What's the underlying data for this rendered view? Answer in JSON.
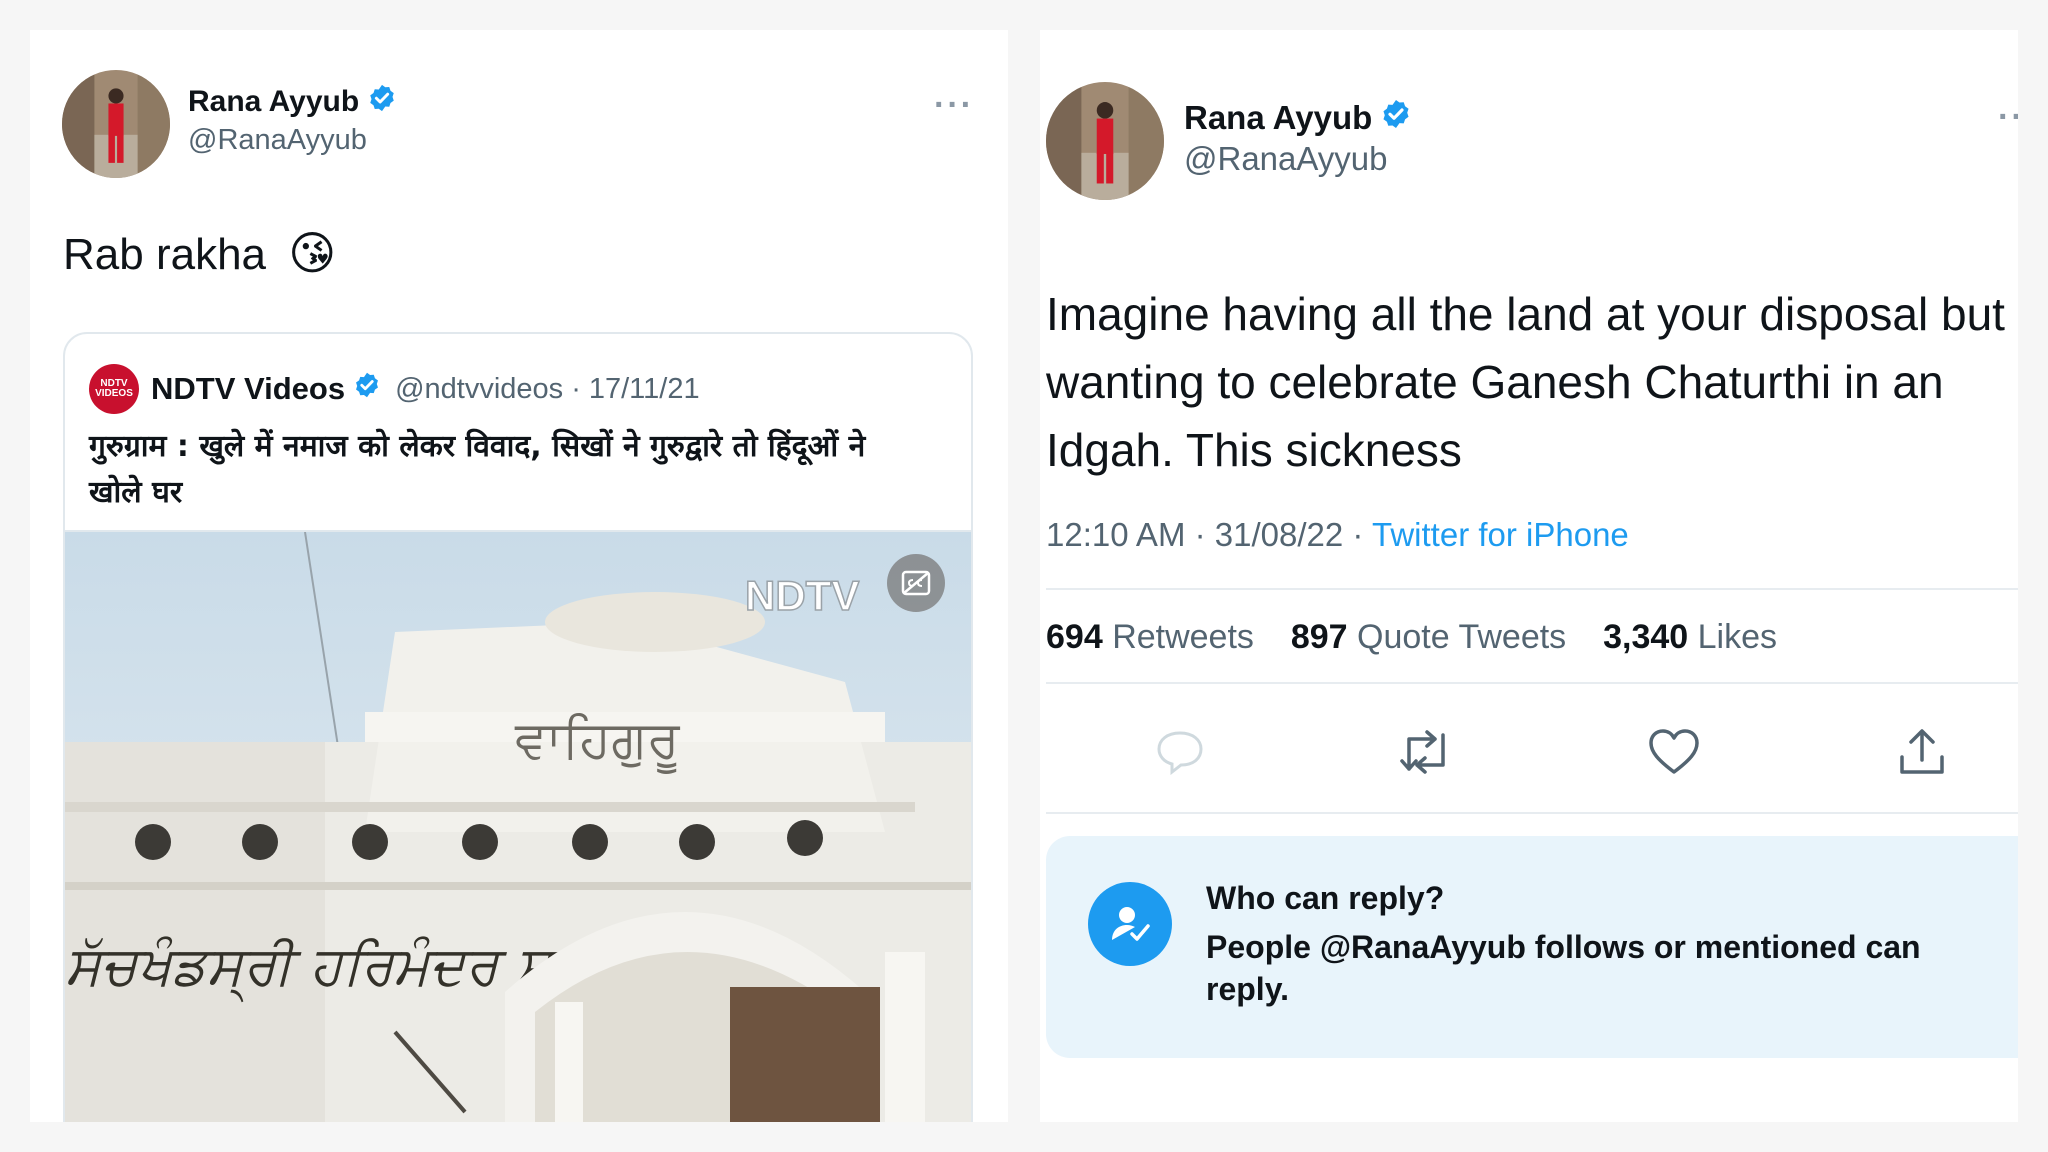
{
  "left_tweet": {
    "author_name": "Rana Ayyub",
    "author_handle": "@RanaAyyub",
    "more_label": "···",
    "text": "Rab rakha",
    "emoji": "😘",
    "quote": {
      "source_logo_text": "NDTV VIDEOS",
      "source_name": "NDTV Videos",
      "source_handle": "@ndtvvideos",
      "separator": "·",
      "date": "17/11/21",
      "text": "गुरुग्राम : खुले में नमाज को लेकर विवाद, सिखों ने गुरुद्वारे तो हिंदूओं ने खोले घर",
      "media_watermark": "NDTV",
      "media_sign_text": "ਵਾਹਿਗੁਰੂ",
      "media_wall_text": "ਸੱਚਖੰਡਸ੍ਰੀ ਹਰਿਮੰਦਰ ਸਾਹਿਬ"
    }
  },
  "right_tweet": {
    "author_name": "Rana Ayyub",
    "author_handle": "@RanaAyyub",
    "more_label": "··",
    "text": "Imagine having all the land at your disposal but wanting to celebrate Ganesh Chaturthi in an Idgah. This sickness",
    "time": "12:10 AM",
    "date": "31/08/22",
    "separator": "·",
    "client": "Twitter for iPhone",
    "stats": {
      "retweets_count": "694",
      "retweets_label": "Retweets",
      "quotes_count": "897",
      "quotes_label": "Quote Tweets",
      "likes_count": "3,340",
      "likes_label": "Likes"
    },
    "reply_notice": {
      "title": "Who can reply?",
      "body": "People @RanaAyyub follows or mentioned can reply."
    }
  },
  "colors": {
    "accent": "#1d9bf0",
    "text_primary": "#0f1419",
    "text_secondary": "#536471",
    "reply_box_bg": "#e8f4fb",
    "ndtv_red": "#c8102e"
  }
}
